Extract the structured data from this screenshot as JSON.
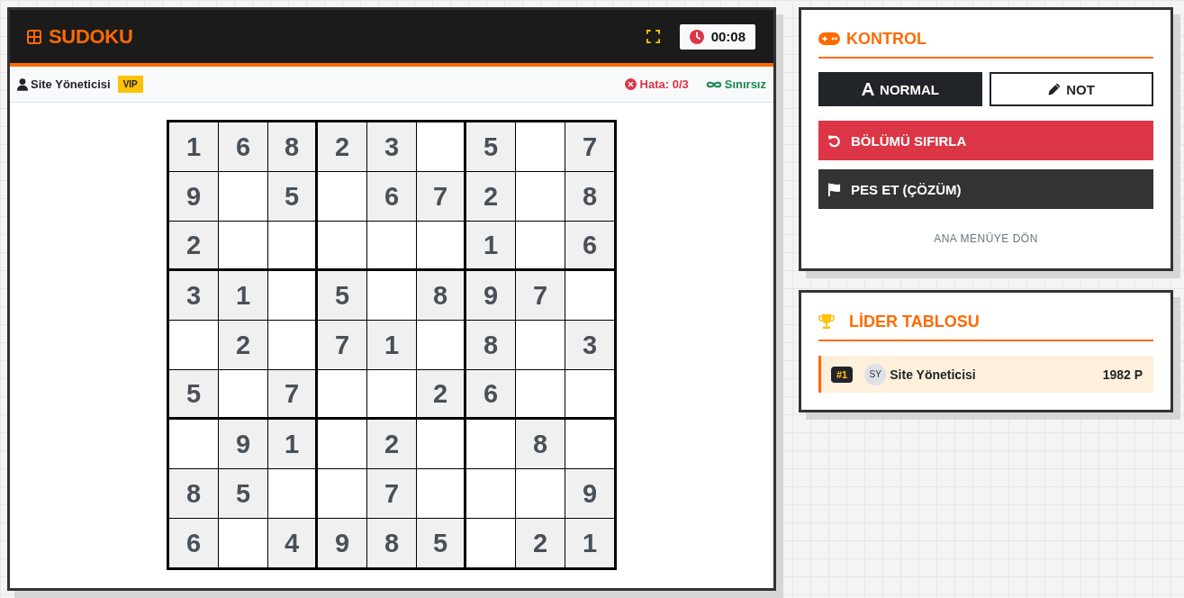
{
  "header": {
    "title": "SUDOKU",
    "timer": "00:08"
  },
  "player_bar": {
    "name": "Site Yöneticisi",
    "badge": "VIP",
    "errors": "Hata: 0/3",
    "limit": "Sınırsız"
  },
  "board": {
    "rows": [
      [
        "1",
        "6",
        "8",
        "2",
        "3",
        null,
        "5",
        null,
        "7"
      ],
      [
        "9",
        null,
        "5",
        null,
        "6",
        "7",
        "2",
        null,
        "8"
      ],
      [
        "2",
        null,
        null,
        null,
        null,
        null,
        "1",
        null,
        "6"
      ],
      [
        "3",
        "1",
        null,
        "5",
        null,
        "8",
        "9",
        "7",
        null
      ],
      [
        null,
        "2",
        null,
        "7",
        "1",
        null,
        "8",
        null,
        "3"
      ],
      [
        "5",
        null,
        "7",
        null,
        null,
        "2",
        "6",
        null,
        null
      ],
      [
        null,
        "9",
        "1",
        null,
        "2",
        null,
        null,
        "8",
        null
      ],
      [
        "8",
        "5",
        null,
        null,
        "7",
        null,
        null,
        null,
        "9"
      ],
      [
        "6",
        null,
        "4",
        "9",
        "8",
        "5",
        null,
        "2",
        "1"
      ]
    ]
  },
  "controls": {
    "title": "KONTROL",
    "modes": [
      {
        "kind": "normal",
        "label": "NORMAL",
        "selected": true
      },
      {
        "kind": "note",
        "label": "NOT",
        "selected": false
      }
    ],
    "actions": [
      {
        "kind": "reset",
        "label": "BÖLÜMÜ SIFIRLA"
      },
      {
        "kind": "give_up",
        "label": "PES ET (ÇÖZÜM)"
      }
    ],
    "link": "ANA MENÜYE DÖN"
  },
  "leaderboard": {
    "title": "LİDER TABLOSU",
    "entries": [
      {
        "rank": "#1",
        "initials": "SY",
        "name": "Site Yöneticisi",
        "points": "1982 P",
        "current": true
      }
    ]
  }
}
